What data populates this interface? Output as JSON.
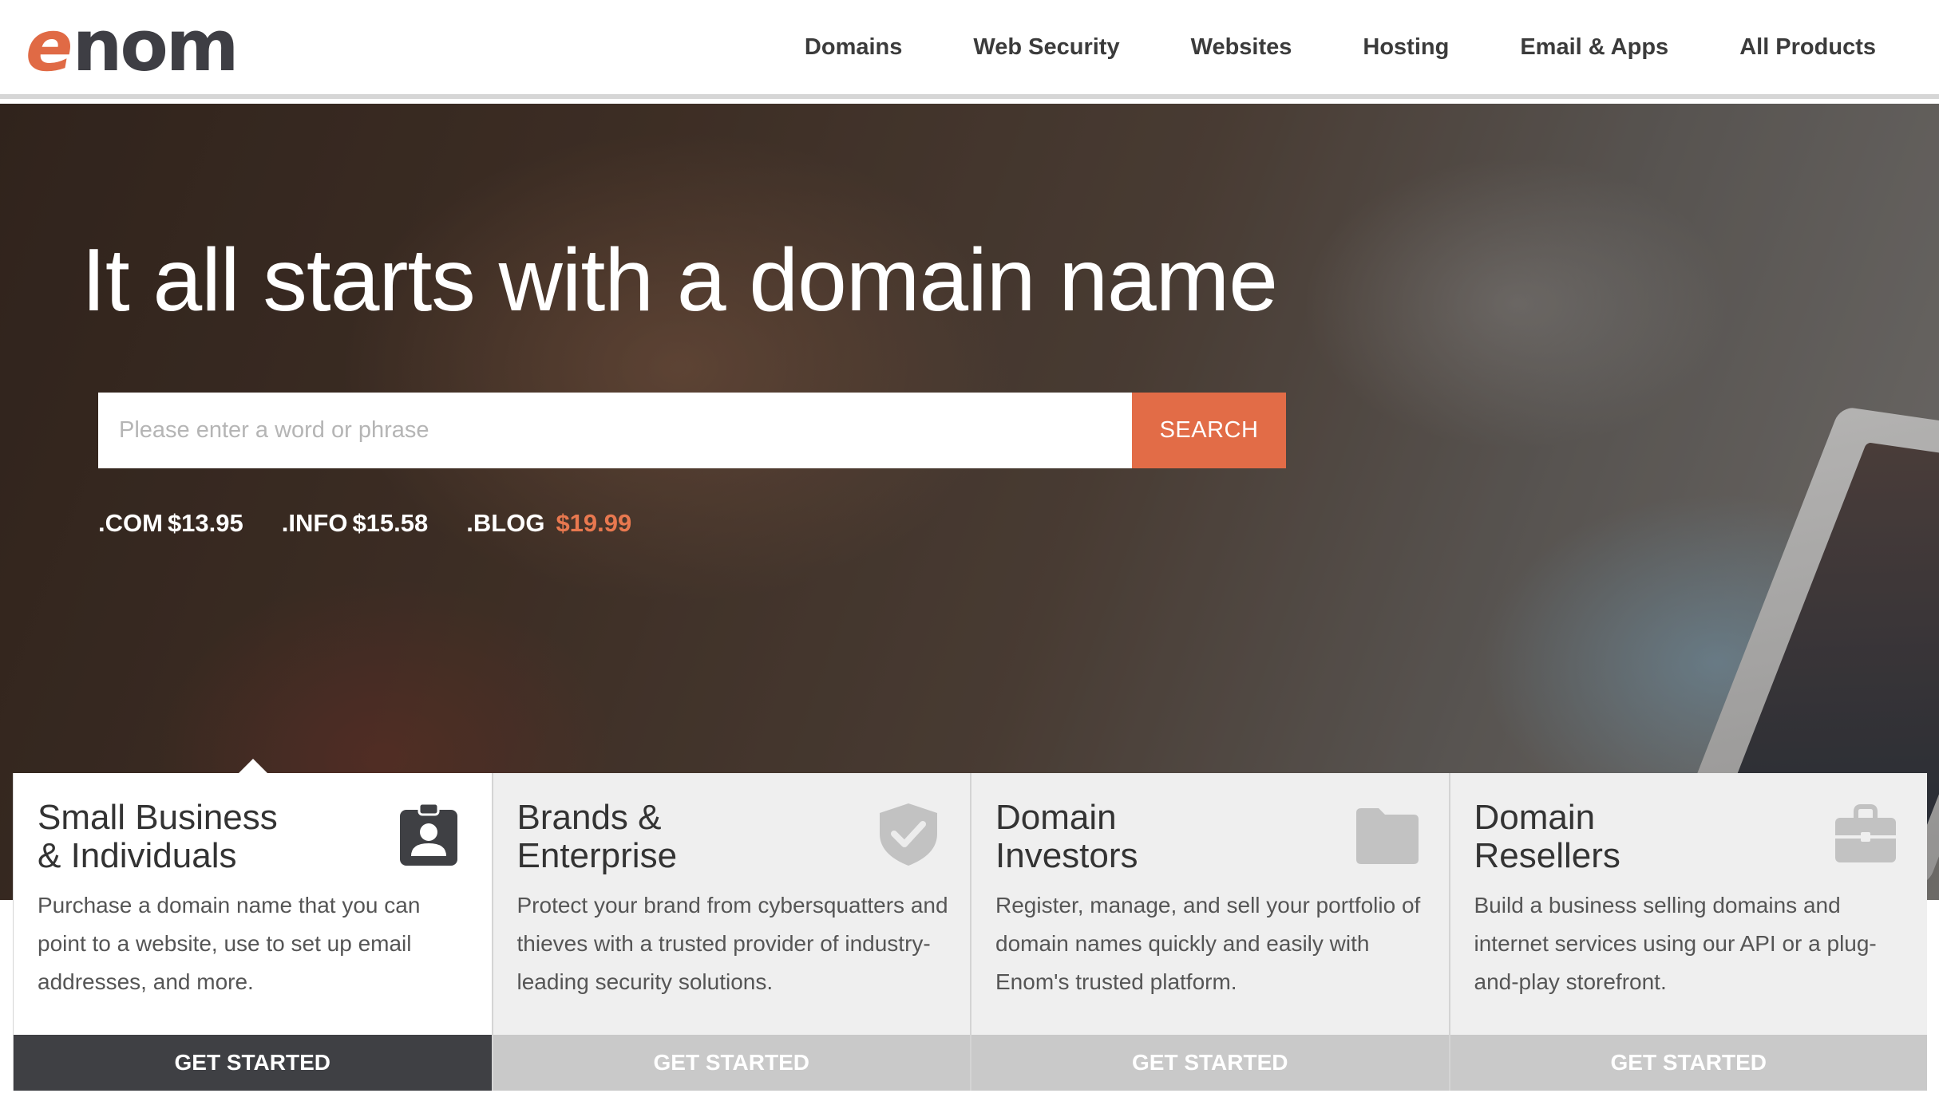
{
  "brand": {
    "logo_e": "e",
    "logo_rest": "nom"
  },
  "nav": {
    "items": [
      {
        "label": "Domains"
      },
      {
        "label": "Web Security"
      },
      {
        "label": "Websites"
      },
      {
        "label": "Hosting"
      },
      {
        "label": "Email & Apps"
      },
      {
        "label": "All Products"
      }
    ]
  },
  "hero": {
    "title": "It all starts with a domain name",
    "search_placeholder": "Please enter a word or phrase",
    "search_value": "",
    "search_button": "SEARCH",
    "prices": [
      {
        "tld": ".COM",
        "amount": "$13.95"
      },
      {
        "tld": ".INFO",
        "amount": "$15.58"
      },
      {
        "tld": ".BLOG",
        "amount": "$19.99"
      }
    ]
  },
  "cards": [
    {
      "title": "Small Business\n& Individuals",
      "description": "Purchase a domain name that you can point to a website, use to set up email addresses, and more.",
      "button": "GET STARTED",
      "icon": "badge-user-icon"
    },
    {
      "title": "Brands &\nEnterprise",
      "description": "Protect your brand from cybersquatters and thieves with a trusted provider of industry-leading security solutions.",
      "button": "GET STARTED",
      "icon": "shield-check-icon"
    },
    {
      "title": "Domain\nInvestors",
      "description": "Register, manage, and sell your portfolio of domain names quickly and easily with Enom's trusted platform.",
      "button": "GET STARTED",
      "icon": "folder-icon"
    },
    {
      "title": "Domain\nResellers",
      "description": "Build a business selling domains and internet services using our API or a plug-and-play storefront.",
      "button": "GET STARTED",
      "icon": "briefcase-icon"
    }
  ],
  "colors": {
    "accent": "#e26c47",
    "dark": "#3f4044",
    "card_bg": "#efefef",
    "card_button_inactive": "#c9c9c9"
  }
}
